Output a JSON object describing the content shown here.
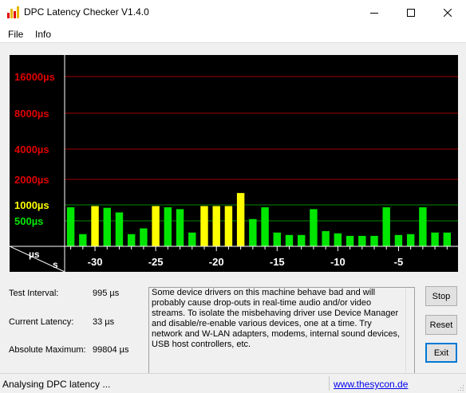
{
  "window": {
    "title": "DPC Latency Checker V1.4.0"
  },
  "menu": {
    "items": [
      "File",
      "Info"
    ]
  },
  "colors": {
    "green": "#00e600",
    "yellow": "#ffff00",
    "red": "#e00000",
    "grid_red": "#a00000",
    "grid_green": "#008800"
  },
  "chart_data": {
    "type": "bar",
    "xlabel": "s",
    "ylabel": "µs",
    "y_scale": "log",
    "y_tick_labels": [
      "16000µs",
      "8000µs",
      "4000µs",
      "2000µs",
      "1000µs",
      "500µs"
    ],
    "y_tick_values": [
      16000,
      8000,
      4000,
      2000,
      1000,
      500
    ],
    "x_ticks": [
      -30,
      -25,
      -20,
      -15,
      -10,
      -5
    ],
    "x_tick_labels": [
      "-30",
      "-25",
      "-20",
      "-15",
      "-10",
      "-5"
    ],
    "x": [
      -32,
      -31,
      -30,
      -29,
      -28,
      -27,
      -26,
      -25,
      -24,
      -23,
      -22,
      -21,
      -20,
      -19,
      -18,
      -17,
      -16,
      -15,
      -14,
      -13,
      -12,
      -11,
      -10,
      -9,
      -8,
      -7,
      -6,
      -5,
      -4,
      -3,
      -2,
      -1
    ],
    "values": [
      900,
      280,
      950,
      880,
      720,
      280,
      360,
      950,
      900,
      830,
      300,
      950,
      950,
      950,
      1380,
      540,
      900,
      300,
      270,
      270,
      830,
      320,
      290,
      260,
      260,
      260,
      900,
      270,
      280,
      900,
      300,
      300
    ],
    "bar_colors": [
      "green",
      "green",
      "yellow",
      "green",
      "green",
      "green",
      "green",
      "yellow",
      "green",
      "green",
      "green",
      "yellow",
      "yellow",
      "yellow",
      "yellow",
      "green",
      "green",
      "green",
      "green",
      "green",
      "green",
      "green",
      "green",
      "green",
      "green",
      "green",
      "green",
      "green",
      "green",
      "green",
      "green",
      "green"
    ]
  },
  "stats": {
    "test_interval_label": "Test Interval:",
    "test_interval_value": "995 µs",
    "current_latency_label": "Current Latency:",
    "current_latency_value": "33 µs",
    "absolute_max_label": "Absolute Maximum:",
    "absolute_max_value": "99804 µs"
  },
  "info_text": "Some device drivers on this machine behave bad and will probably cause drop-outs in real-time audio and/or video streams. To isolate the misbehaving driver use Device Manager and disable/re-enable various devices, one at a time. Try network and W-LAN adapters, modems, internal sound devices, USB host controllers, etc.",
  "buttons": {
    "stop": "Stop",
    "reset": "Reset",
    "exit": "Exit"
  },
  "status": {
    "text": "Analysing DPC latency ...",
    "link": "www.thesycon.de"
  }
}
